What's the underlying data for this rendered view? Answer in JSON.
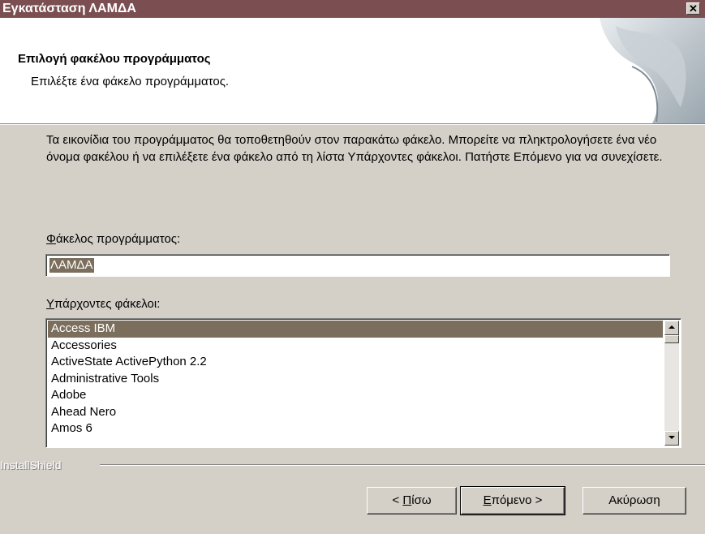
{
  "window": {
    "title": "Εγκατάσταση ΛΑΜΔΑ",
    "close_glyph": "✕"
  },
  "header": {
    "title": "Επιλογή φακέλου προγράμματος",
    "subtitle": "Επιλέξτε ένα φάκελο προγράμματος."
  },
  "description": "Τα εικονίδια του προγράμματος θα τοποθετηθούν στον παρακάτω φάκελο. Μπορείτε να πληκτρολογήσετε ένα νέο όνομα φακέλου ή να επιλέξετε ένα φάκελο από τη λίστα Υπάρχοντες φάκελοι. Πατήστε Επόμενο για να συνεχίσετε.",
  "program_folder": {
    "label_accel": "Φ",
    "label_rest": "άκελος προγράμματος:",
    "value": "ΛΑΜΔΑ"
  },
  "existing_folders": {
    "label_accel": "Υ",
    "label_rest": "πάρχοντες φάκελοι:",
    "items": [
      "Access IBM",
      "Accessories",
      "ActiveState ActivePython 2.2",
      "Administrative Tools",
      "Adobe",
      "Ahead Nero",
      "Amos 6"
    ],
    "selected_index": 0
  },
  "brand": "InstallShield",
  "buttons": {
    "back": {
      "prefix": "< ",
      "accel": "Π",
      "rest": "ίσω"
    },
    "next": {
      "accel": "Ε",
      "rest": "πόμενο >"
    },
    "cancel": {
      "label": "Ακύρωση"
    }
  },
  "colors": {
    "titlebar": "#7b4f52",
    "selection": "#7b6e5c",
    "face": "#d4d0c8"
  },
  "icons": {
    "close": "close-icon",
    "scroll_up": "arrow-up-icon",
    "scroll_down": "arrow-down-icon"
  }
}
